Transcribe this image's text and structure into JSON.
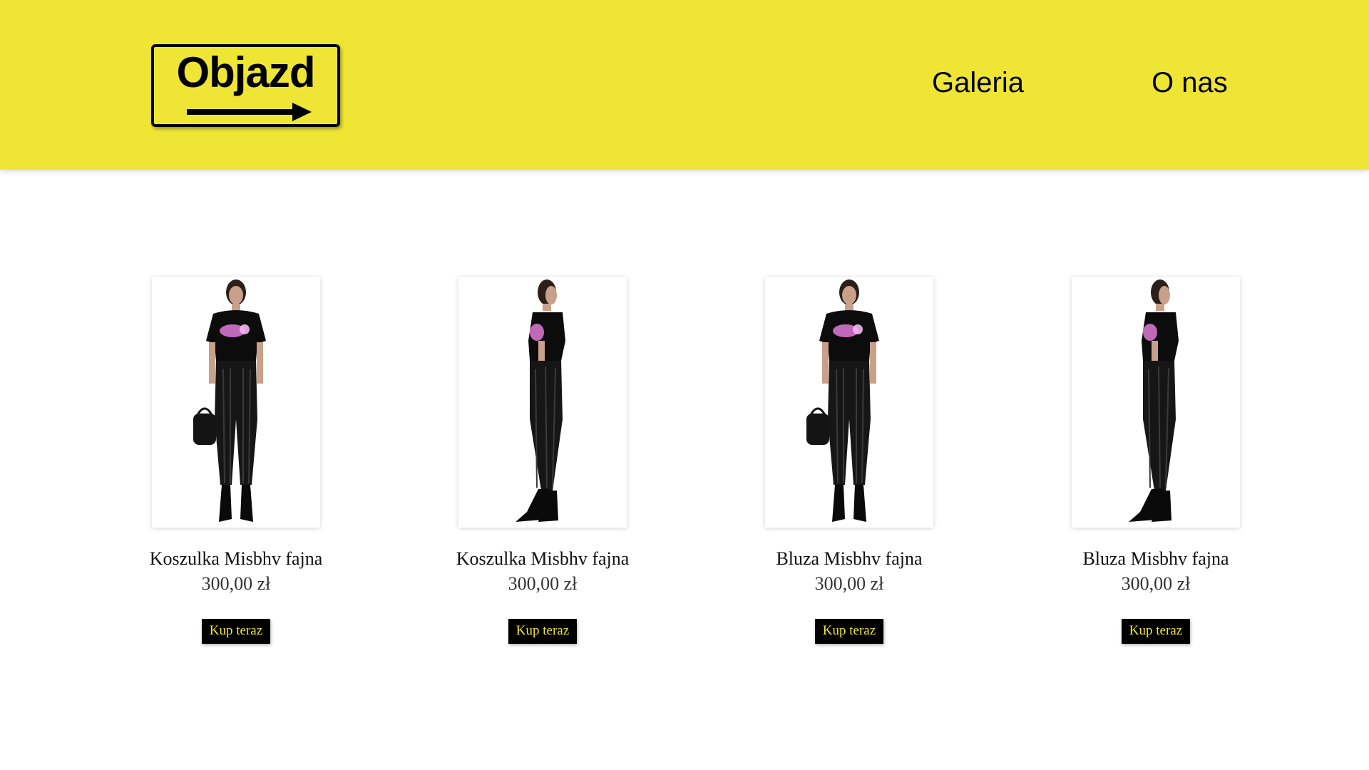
{
  "brand": {
    "logo_text": "Objazd"
  },
  "nav": {
    "galeria": "Galeria",
    "o_nas": "O nas"
  },
  "colors": {
    "header_bg": "#efe535",
    "button_bg": "#000000",
    "button_text": "#efe535"
  },
  "products": [
    {
      "name": "Koszulka Misbhv fajna",
      "price": "300,00 zł",
      "button": "Kup teraz",
      "view": "front"
    },
    {
      "name": "Koszulka Misbhv fajna",
      "price": "300,00 zł",
      "button": "Kup teraz",
      "view": "side"
    },
    {
      "name": "Bluza Misbhv fajna",
      "price": "300,00 zł",
      "button": "Kup teraz",
      "view": "front"
    },
    {
      "name": "Bluza Misbhv fajna",
      "price": "300,00 zł",
      "button": "Kup teraz",
      "view": "side"
    }
  ]
}
